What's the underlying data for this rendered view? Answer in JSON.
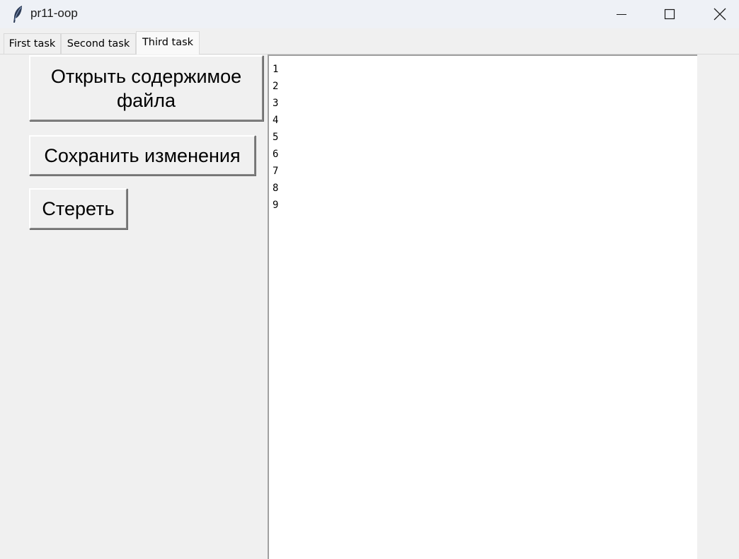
{
  "window": {
    "title": "pr11-oop",
    "icon": "feather-icon"
  },
  "tabs": [
    {
      "label": "First task",
      "selected": false
    },
    {
      "label": "Second task",
      "selected": false
    },
    {
      "label": "Third task",
      "selected": true
    }
  ],
  "buttons": {
    "open_line1": "Открыть содержимое",
    "open_line2": "файла",
    "save": "Сохранить изменения",
    "clear": "Стереть"
  },
  "editor": {
    "lines": [
      "1",
      "2",
      "3",
      "4",
      "5",
      "6",
      "7",
      "8",
      "9"
    ]
  }
}
